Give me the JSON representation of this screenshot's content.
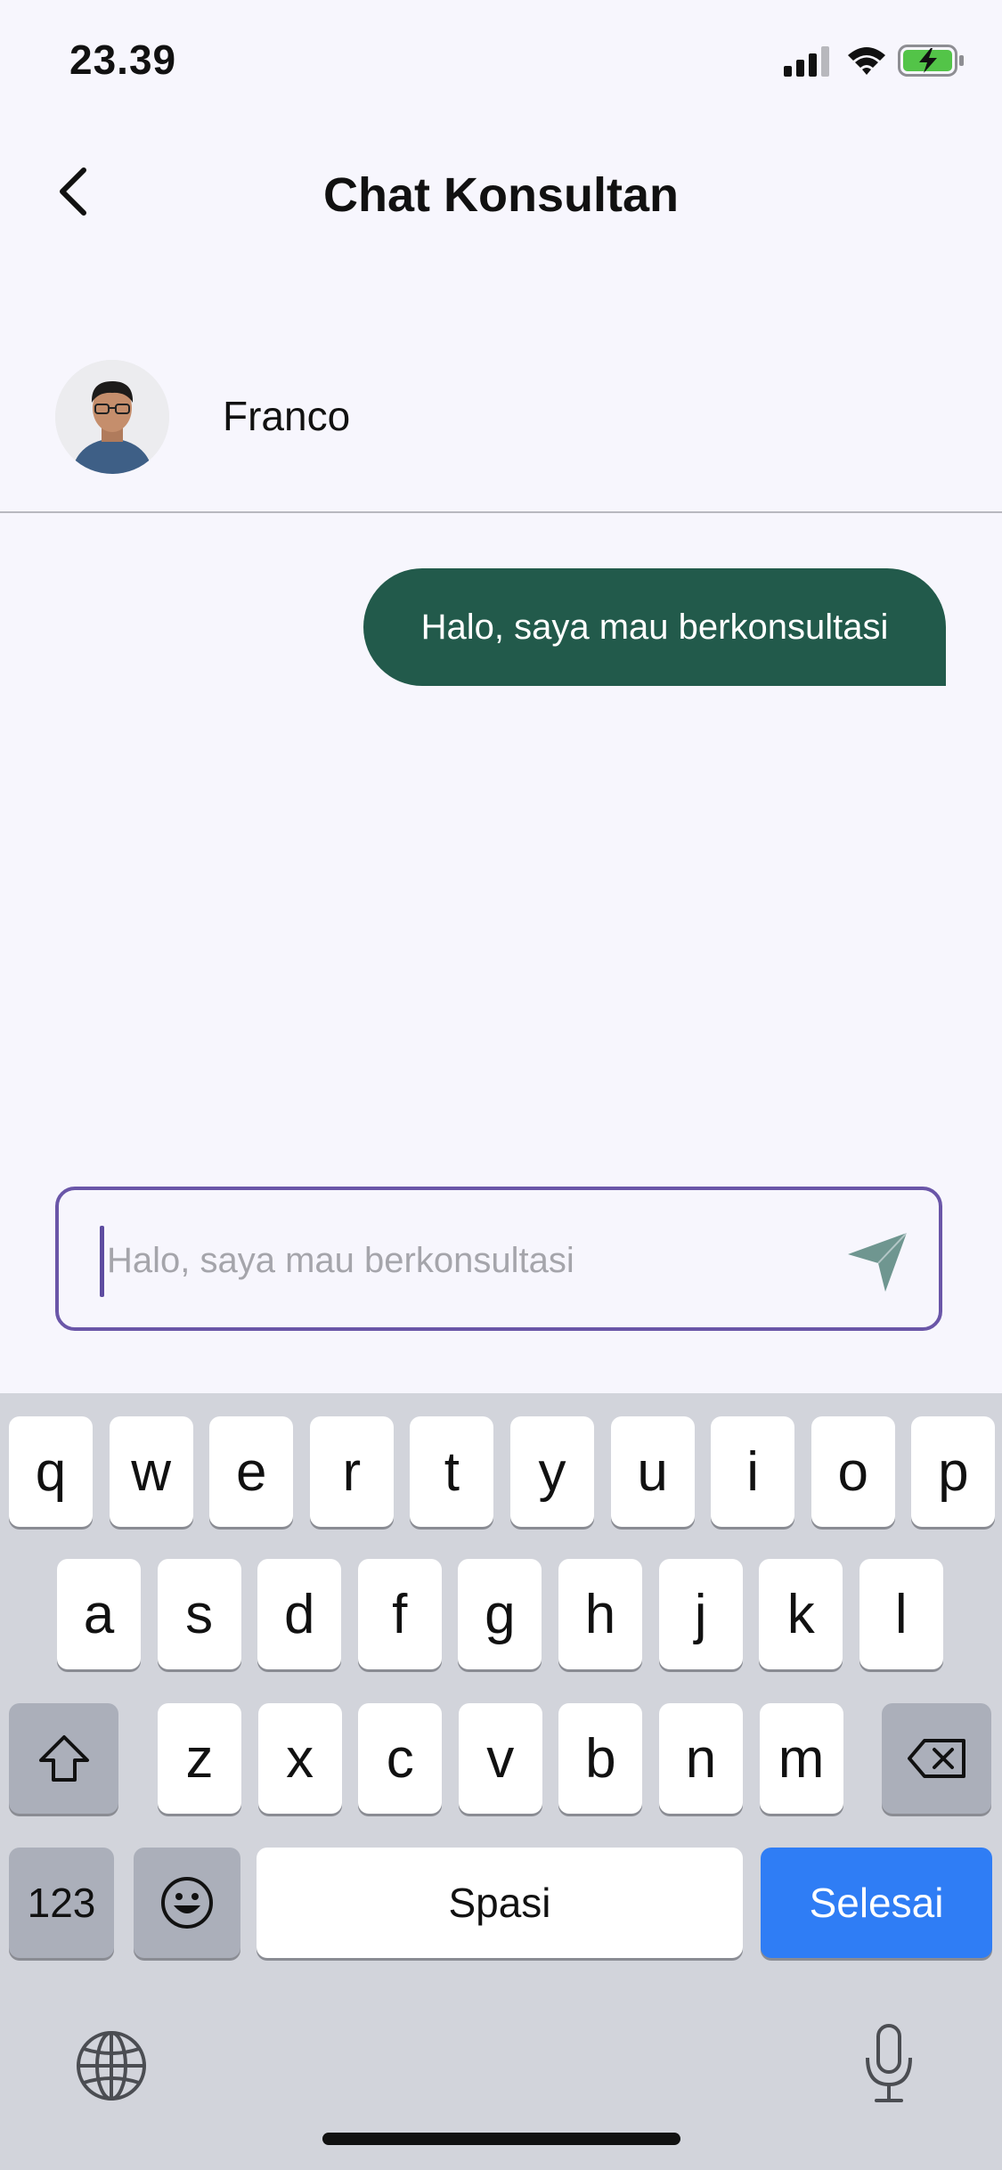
{
  "status_bar": {
    "time": "23.39"
  },
  "header": {
    "title": "Chat Konsultan",
    "back_icon": "chevron-left-icon"
  },
  "contact": {
    "name": "Franco"
  },
  "messages": [
    {
      "text": "Halo, saya mau berkonsultasi",
      "from": "me"
    }
  ],
  "composer": {
    "placeholder": "Halo, saya mau berkonsultasi",
    "value": "",
    "send_icon": "send-icon"
  },
  "keyboard": {
    "row1": [
      "q",
      "w",
      "e",
      "r",
      "t",
      "y",
      "u",
      "i",
      "o",
      "p"
    ],
    "row2": [
      "a",
      "s",
      "d",
      "f",
      "g",
      "h",
      "j",
      "k",
      "l"
    ],
    "row3": [
      "z",
      "x",
      "c",
      "v",
      "b",
      "n",
      "m"
    ],
    "numbers_label": "123",
    "space_label": "Spasi",
    "done_label": "Selesai"
  },
  "colors": {
    "bubble": "#225a4b",
    "accent": "#6a56a8",
    "done_key": "#2f7df5",
    "background": "#f7f6fd"
  }
}
